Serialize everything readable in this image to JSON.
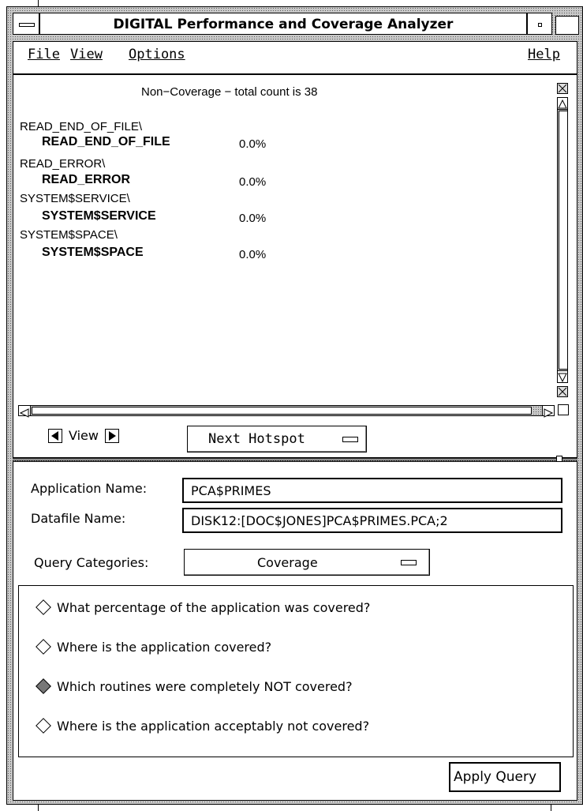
{
  "window": {
    "title": "DIGITAL Performance and Coverage Analyzer"
  },
  "menu": {
    "file": "File",
    "view": "View",
    "options": "Options",
    "help": "Help"
  },
  "results": {
    "header": "Non−Coverage − total count is 38",
    "rows": [
      {
        "module": "READ_END_OF_FILE\\",
        "routine": "READ_END_OF_FILE",
        "percent": "0.0%"
      },
      {
        "module": "READ_ERROR\\",
        "routine": "READ_ERROR",
        "percent": "0.0%"
      },
      {
        "module": "SYSTEM$SERVICE\\",
        "routine": "SYSTEM$SERVICE",
        "percent": "0.0%"
      },
      {
        "module": "SYSTEM$SPACE\\",
        "routine": "SYSTEM$SPACE",
        "percent": "0.0%"
      }
    ]
  },
  "navigation": {
    "view_label": "View",
    "next_hotspot": "Next Hotspot"
  },
  "form": {
    "application_label": "Application Name:",
    "application_value": "PCA$PRIMES",
    "datafile_label": "Datafile Name:",
    "datafile_value": "DISK12:[DOC$JONES]PCA$PRIMES.PCA;2",
    "query_categories_label": "Query Categories:",
    "query_category_value": "Coverage"
  },
  "queries": [
    {
      "text": "What percentage of the application was covered?",
      "selected": false
    },
    {
      "text": "Where is the application covered?",
      "selected": false
    },
    {
      "text": "Which routines were completely NOT covered?",
      "selected": true
    },
    {
      "text": "Where is the application acceptably not covered?",
      "selected": false
    }
  ],
  "apply_button": "Apply Query"
}
